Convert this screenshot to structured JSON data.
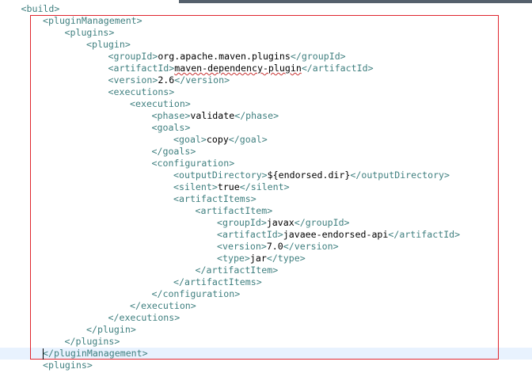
{
  "editor": {
    "file_type": "xml",
    "current_line_index": 29,
    "lines": [
      {
        "indent": 1,
        "parts": [
          {
            "t": "tag",
            "v": "<build>"
          }
        ]
      },
      {
        "indent": 2,
        "parts": [
          {
            "t": "tag",
            "v": "<pluginManagement>"
          }
        ]
      },
      {
        "indent": 3,
        "parts": [
          {
            "t": "tag",
            "v": "<plugins>"
          }
        ]
      },
      {
        "indent": 4,
        "parts": [
          {
            "t": "tag",
            "v": "<plugin>"
          }
        ]
      },
      {
        "indent": 5,
        "parts": [
          {
            "t": "tag",
            "v": "<groupId>"
          },
          {
            "t": "txt",
            "v": "org.apache.maven.plugins"
          },
          {
            "t": "tag",
            "v": "</groupId>"
          }
        ]
      },
      {
        "indent": 5,
        "parts": [
          {
            "t": "tag",
            "v": "<artifactId>"
          },
          {
            "t": "txt",
            "v": "maven-dependency-plugin",
            "spell": true
          },
          {
            "t": "tag",
            "v": "</artifactId>"
          }
        ]
      },
      {
        "indent": 5,
        "parts": [
          {
            "t": "tag",
            "v": "<version>"
          },
          {
            "t": "txt",
            "v": "2.6"
          },
          {
            "t": "tag",
            "v": "</version>"
          }
        ]
      },
      {
        "indent": 5,
        "parts": [
          {
            "t": "tag",
            "v": "<executions>"
          }
        ]
      },
      {
        "indent": 6,
        "parts": [
          {
            "t": "tag",
            "v": "<execution>"
          }
        ]
      },
      {
        "indent": 7,
        "parts": [
          {
            "t": "tag",
            "v": "<phase>"
          },
          {
            "t": "txt",
            "v": "validate"
          },
          {
            "t": "tag",
            "v": "</phase>"
          }
        ]
      },
      {
        "indent": 7,
        "parts": [
          {
            "t": "tag",
            "v": "<goals>"
          }
        ]
      },
      {
        "indent": 8,
        "parts": [
          {
            "t": "tag",
            "v": "<goal>"
          },
          {
            "t": "txt",
            "v": "copy"
          },
          {
            "t": "tag",
            "v": "</goal>"
          }
        ]
      },
      {
        "indent": 7,
        "parts": [
          {
            "t": "tag",
            "v": "</goals>"
          }
        ]
      },
      {
        "indent": 7,
        "parts": [
          {
            "t": "tag",
            "v": "<configuration>"
          }
        ]
      },
      {
        "indent": 8,
        "parts": [
          {
            "t": "tag",
            "v": "<outputDirectory>"
          },
          {
            "t": "txt",
            "v": "${endorsed.dir}"
          },
          {
            "t": "tag",
            "v": "</outputDirectory>"
          }
        ]
      },
      {
        "indent": 8,
        "parts": [
          {
            "t": "tag",
            "v": "<silent>"
          },
          {
            "t": "txt",
            "v": "true"
          },
          {
            "t": "tag",
            "v": "</silent>"
          }
        ]
      },
      {
        "indent": 8,
        "parts": [
          {
            "t": "tag",
            "v": "<artifactItems>"
          }
        ]
      },
      {
        "indent": 9,
        "parts": [
          {
            "t": "tag",
            "v": "<artifactItem>"
          }
        ]
      },
      {
        "indent": 10,
        "parts": [
          {
            "t": "tag",
            "v": "<groupId>"
          },
          {
            "t": "txt",
            "v": "javax"
          },
          {
            "t": "tag",
            "v": "</groupId>"
          }
        ]
      },
      {
        "indent": 10,
        "parts": [
          {
            "t": "tag",
            "v": "<artifactId>"
          },
          {
            "t": "txt",
            "v": "javaee-endorsed-api"
          },
          {
            "t": "tag",
            "v": "</artifactId>"
          }
        ]
      },
      {
        "indent": 10,
        "parts": [
          {
            "t": "tag",
            "v": "<version>"
          },
          {
            "t": "txt",
            "v": "7.0"
          },
          {
            "t": "tag",
            "v": "</version>"
          }
        ]
      },
      {
        "indent": 10,
        "parts": [
          {
            "t": "tag",
            "v": "<type>"
          },
          {
            "t": "txt",
            "v": "jar"
          },
          {
            "t": "tag",
            "v": "</type>"
          }
        ]
      },
      {
        "indent": 9,
        "parts": [
          {
            "t": "tag",
            "v": "</artifactItem>"
          }
        ]
      },
      {
        "indent": 8,
        "parts": [
          {
            "t": "tag",
            "v": "</artifactItems>"
          }
        ]
      },
      {
        "indent": 7,
        "parts": [
          {
            "t": "tag",
            "v": "</configuration>"
          }
        ]
      },
      {
        "indent": 6,
        "parts": [
          {
            "t": "tag",
            "v": "</execution>"
          }
        ]
      },
      {
        "indent": 5,
        "parts": [
          {
            "t": "tag",
            "v": "</executions>"
          }
        ]
      },
      {
        "indent": 4,
        "parts": [
          {
            "t": "tag",
            "v": "</plugin>"
          }
        ]
      },
      {
        "indent": 3,
        "parts": [
          {
            "t": "tag",
            "v": "</plugins>"
          }
        ]
      },
      {
        "indent": 2,
        "parts": [
          {
            "t": "tag",
            "v": "</pluginManagement>"
          }
        ]
      },
      {
        "indent": 2,
        "parts": [
          {
            "t": "tag",
            "v": "<plugins>"
          }
        ]
      }
    ]
  },
  "colors": {
    "tag": "#3f7f7f",
    "text": "#000000",
    "current_line": "#e8f2fe",
    "annotation_box": "#e0262e",
    "spellcheck_underline": "#c83232"
  }
}
